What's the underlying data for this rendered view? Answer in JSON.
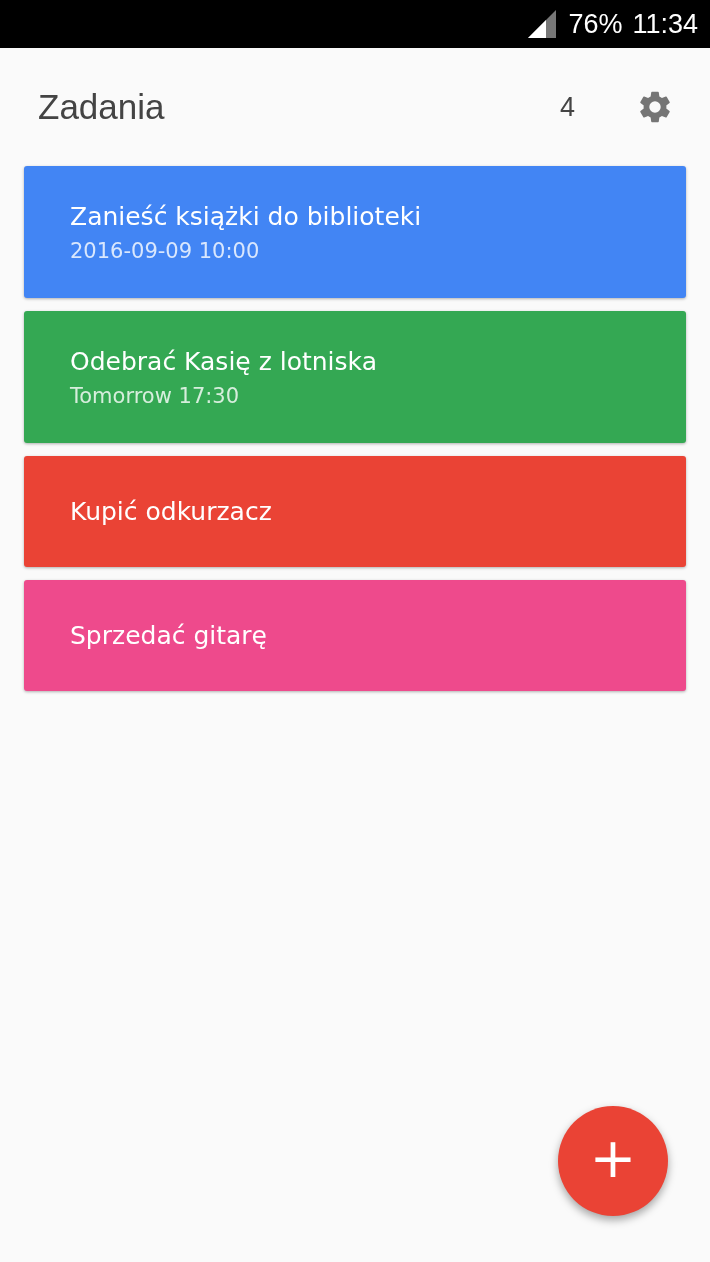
{
  "status_bar": {
    "battery": "76%",
    "time": "11:34"
  },
  "header": {
    "title": "Zadania",
    "count": "4"
  },
  "tasks": [
    {
      "title": "Zanieść książki do biblioteki",
      "due": "2016-09-09 10:00",
      "color": "#4285f4"
    },
    {
      "title": "Odebrać Kasię z lotniska",
      "due": "Tomorrow 17:30",
      "color": "#34a853"
    },
    {
      "title": "Kupić odkurzacz",
      "color": "#ea4335"
    },
    {
      "title": "Sprzedać gitarę",
      "color": "#ee4a8c"
    }
  ],
  "fab": {
    "label": "+"
  }
}
